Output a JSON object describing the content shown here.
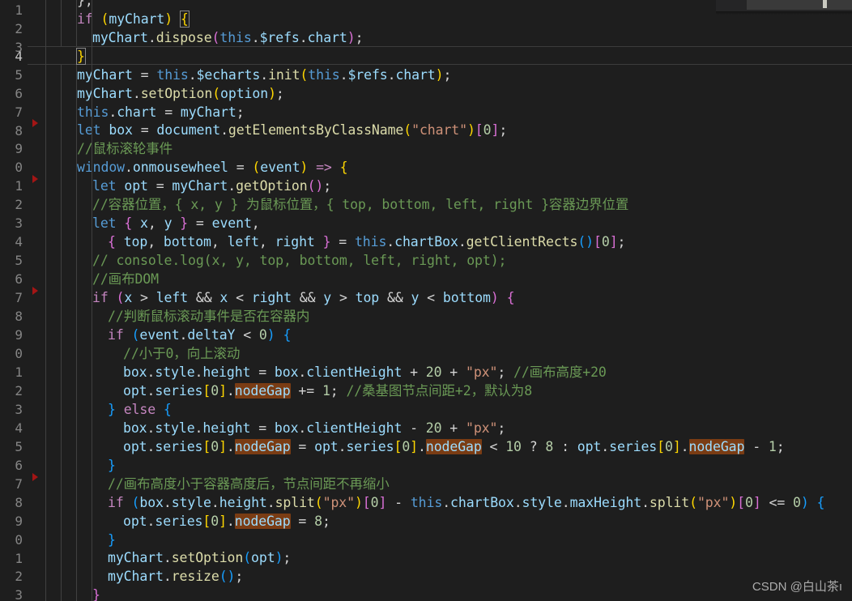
{
  "editor": {
    "theme_background": "#1e1e1e",
    "gutter_color": "#858585",
    "active_line_number_color": "#c6c6c6",
    "occurrence_highlight_color": "#7a3c14",
    "breakpoint_color": "#a31515",
    "indent_guide_color": "#404040",
    "active_line": 4,
    "first_visible_line_number": 1,
    "line_numbers": [
      "1",
      "2",
      "3",
      "4",
      "5",
      "6",
      "7",
      "8",
      "9",
      "0",
      "1",
      "2",
      "3",
      "4",
      "5",
      "6",
      "7",
      "8",
      "9",
      "0",
      "1",
      "2",
      "3",
      "4",
      "5",
      "6",
      "7",
      "8",
      "9",
      "0",
      "1",
      "2",
      "3"
    ],
    "breakpoint_lines": [
      8,
      11,
      17,
      27
    ],
    "highlighted_token": "nodeGap",
    "code_lines": [
      "    };",
      "    if (myChart) {",
      "      myChart.dispose(this.$refs.chart);",
      "    }",
      "    myChart = this.$echarts.init(this.$refs.chart);",
      "    myChart.setOption(option);",
      "    this.chart = myChart;",
      "    let box = document.getElementsByClassName(\"chart\")[0];",
      "    //鼠标滚轮事件",
      "    window.onmousewheel = (event) => {",
      "      let opt = myChart.getOption();",
      "      //容器位置，{ x, y } 为鼠标位置，{ top, bottom, left, right }容器边界位置",
      "      let { x, y } = event,",
      "        { top, bottom, left, right } = this.chartBox.getClientRects()[0];",
      "      // console.log(x, y, top, bottom, left, right, opt);",
      "      //画布DOM",
      "      if (x > left && x < right && y > top && y < bottom) {",
      "        //判断鼠标滚动事件是否在容器内",
      "        if (event.deltaY < 0) {",
      "          //小于0，向上滚动",
      "          box.style.height = box.clientHeight + 20 + \"px\"; //画布高度+20",
      "          opt.series[0].nodeGap += 1; //桑基图节点间距+2，默认为8",
      "        } else {",
      "          box.style.height = box.clientHeight - 20 + \"px\";",
      "          opt.series[0].nodeGap = opt.series[0].nodeGap < 10 ? 8 : opt.series[0].nodeGap - 1;",
      "        }",
      "        //画布高度小于容器高度后，节点间距不再缩小",
      "        if (box.style.height.split(\"px\")[0] - this.chartBox.style.maxHeight.split(\"px\")[0] <= 0) {",
      "          opt.series[0].nodeGap = 8;",
      "        }",
      "        myChart.setOption(opt);",
      "        myChart.resize();",
      "      }"
    ]
  },
  "watermark": {
    "text": "CSDN @白山茶ı"
  }
}
